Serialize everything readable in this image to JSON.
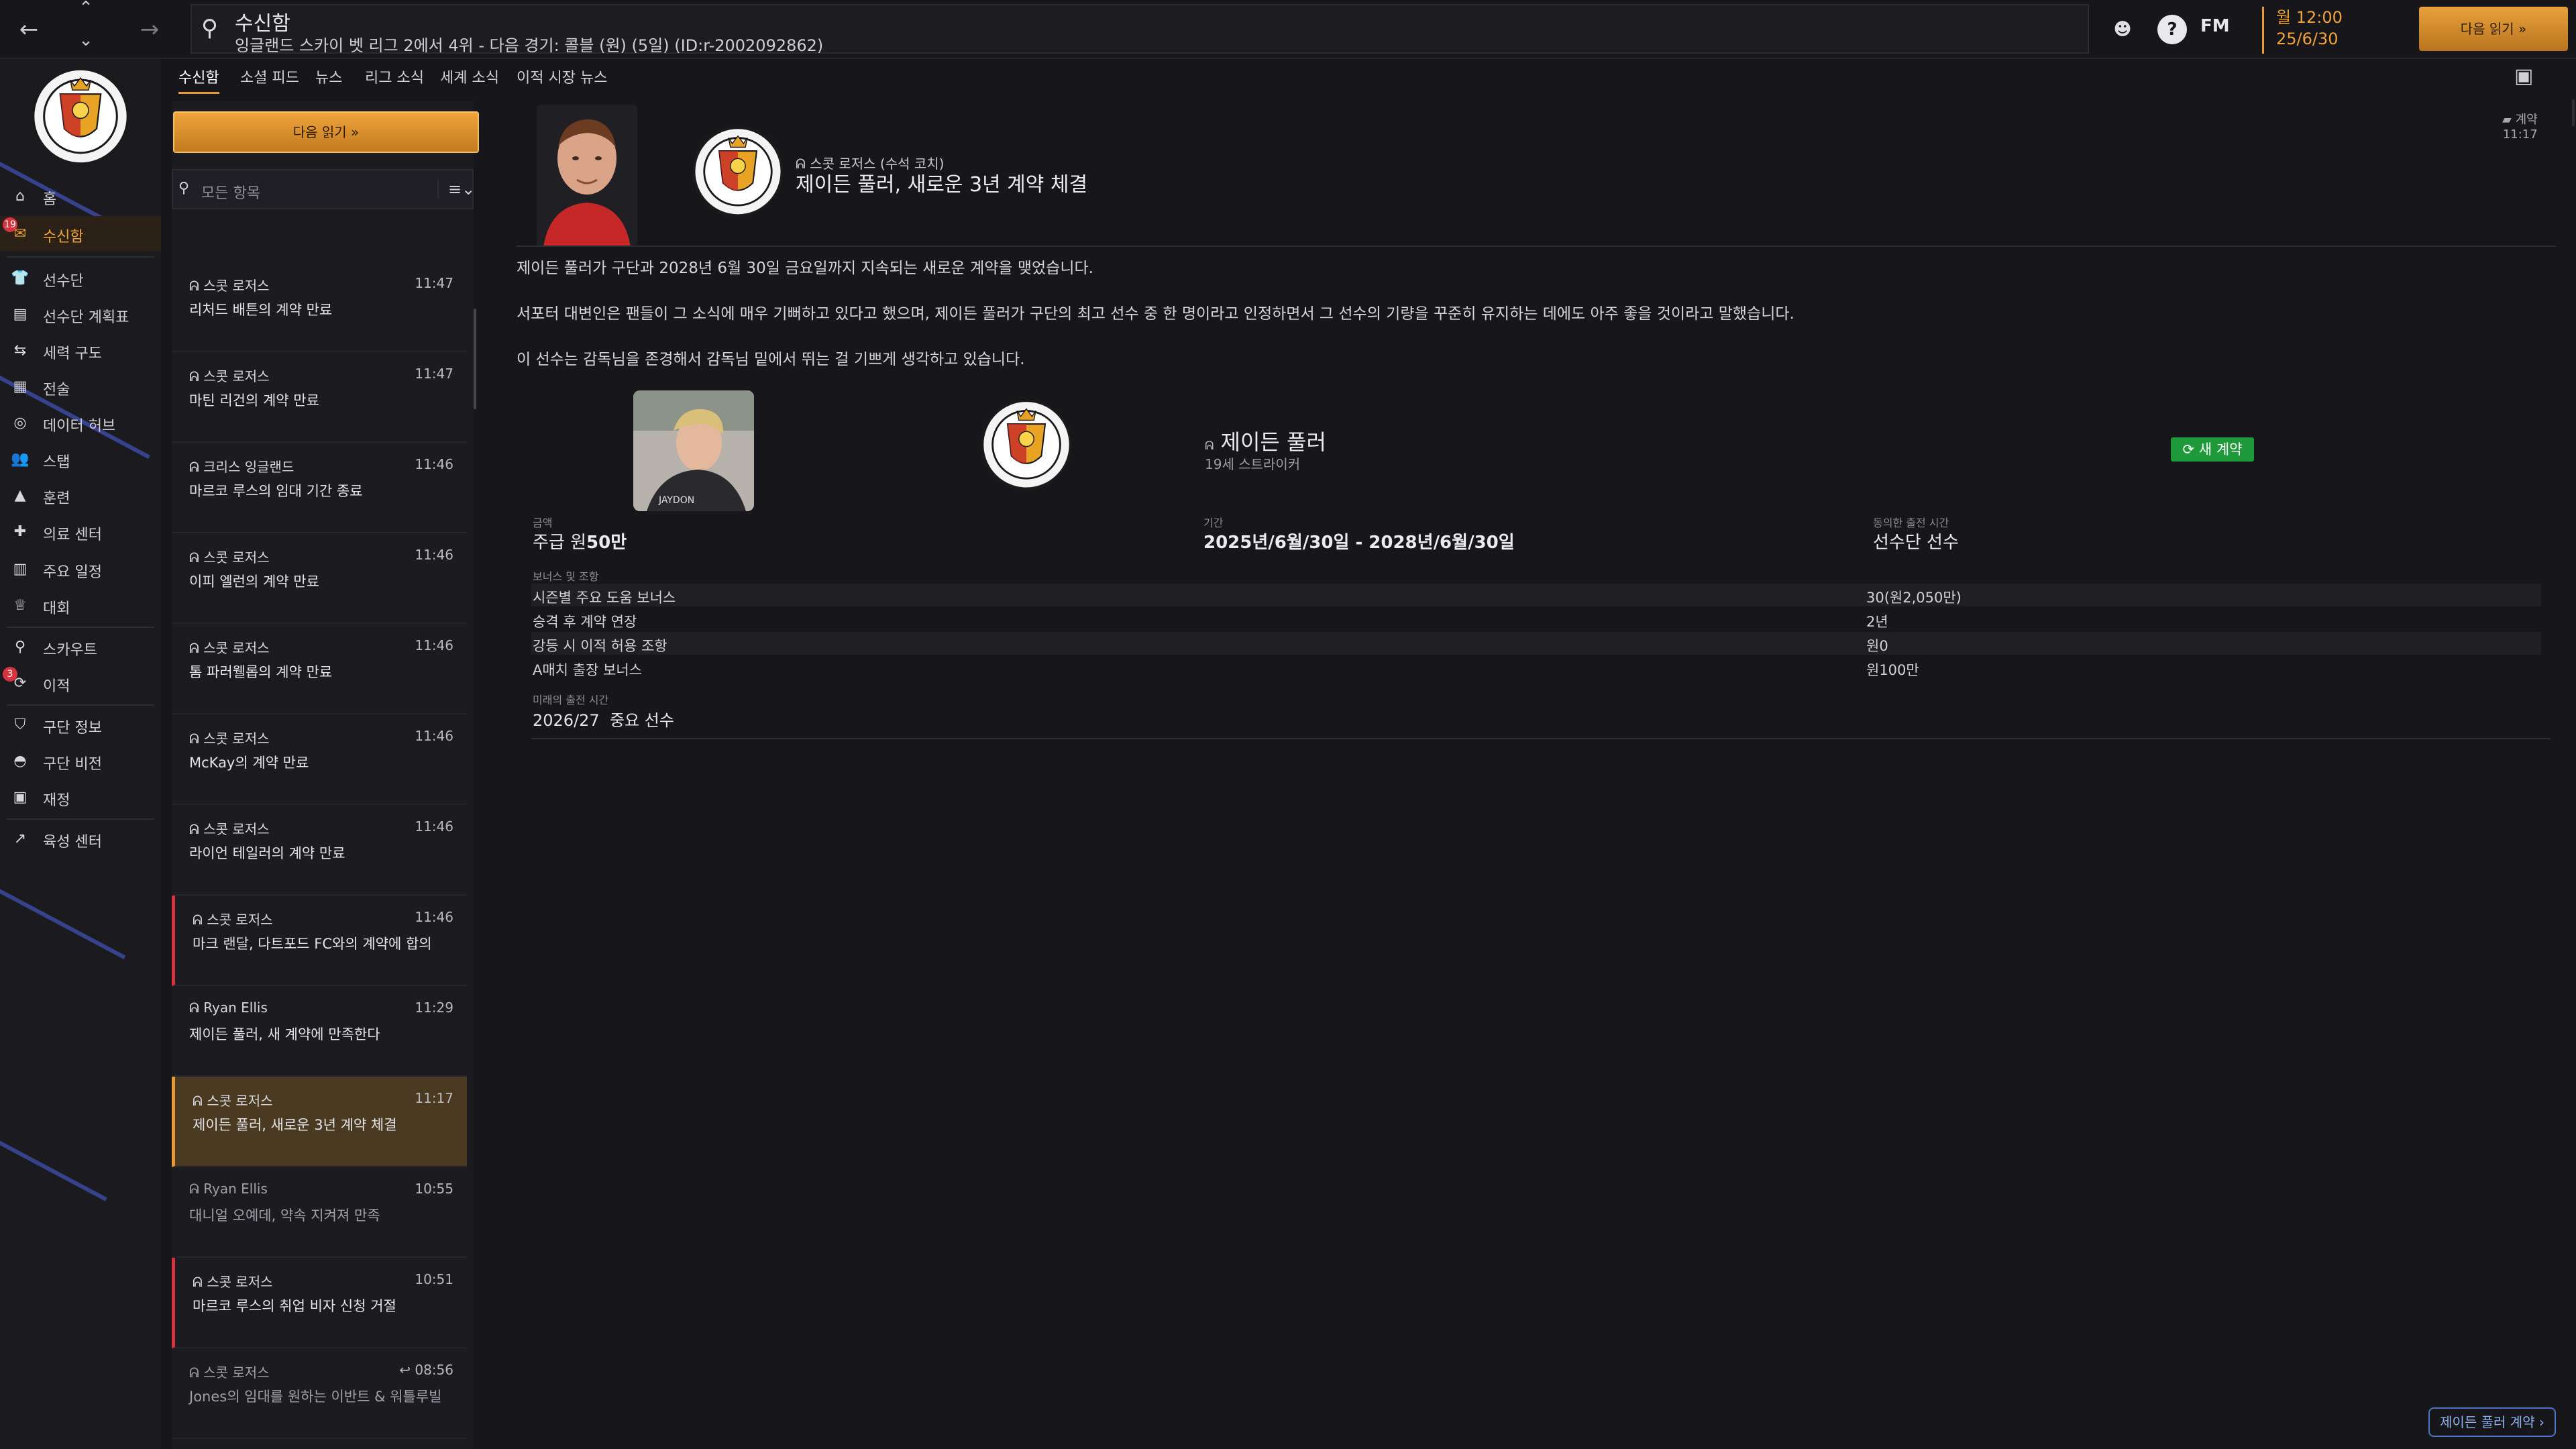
{
  "window": {
    "title": "수신함",
    "subtitle": "잉글랜드 스카이 벳 리그 2에서 4위 - 다음 경기: 콜블 (원) (5일) (ID:r-2002092862)"
  },
  "topbar": {
    "fm_label": "FM",
    "time": "월 12:00",
    "date": "25/6/30",
    "continue_label": "다음 읽기"
  },
  "sidebar": {
    "items": [
      {
        "label": "홈",
        "icon": "home-icon"
      },
      {
        "label": "수신함",
        "icon": "inbox-icon",
        "badge": "19",
        "active": true
      },
      {
        "label": "선수단",
        "icon": "shirt-icon"
      },
      {
        "label": "선수단 계획표",
        "icon": "clipboard-icon"
      },
      {
        "label": "세력 구도",
        "icon": "dynamics-icon"
      },
      {
        "label": "전술",
        "icon": "tactics-icon"
      },
      {
        "label": "데이터 허브",
        "icon": "data-hub-icon"
      },
      {
        "label": "스탭",
        "icon": "staff-icon"
      },
      {
        "label": "훈련",
        "icon": "training-icon"
      },
      {
        "label": "의료 센터",
        "icon": "medical-icon"
      },
      {
        "label": "주요 일정",
        "icon": "calendar-icon"
      },
      {
        "label": "대회",
        "icon": "trophy-icon"
      },
      {
        "label": "스카우트",
        "icon": "scout-icon"
      },
      {
        "label": "이적",
        "icon": "transfer-icon",
        "badge": "3"
      },
      {
        "label": "구단 정보",
        "icon": "club-info-icon"
      },
      {
        "label": "구단 비전",
        "icon": "vision-icon"
      },
      {
        "label": "재정",
        "icon": "finance-icon"
      },
      {
        "label": "육성 센터",
        "icon": "development-icon"
      }
    ]
  },
  "tabs": [
    "수신함",
    "소셜 피드",
    "뉴스",
    "리그 소식",
    "세계 소식",
    "이적 시장 뉴스"
  ],
  "list": {
    "read_next": "다음 읽기  »",
    "filter_placeholder": "모든 항목",
    "messages": [
      {
        "sender": "스콧 로저스",
        "time": "11:47",
        "subject": "리처드 배튼의 계약 만료",
        "flag": false,
        "sel": false,
        "read": false
      },
      {
        "sender": "스콧 로저스",
        "time": "11:47",
        "subject": "마틴 리건의 계약 만료",
        "flag": false,
        "sel": false,
        "read": false
      },
      {
        "sender": "크리스 잉글랜드",
        "time": "11:46",
        "subject": "마르코 루스의 임대 기간 종료",
        "flag": false,
        "sel": false,
        "read": false
      },
      {
        "sender": "스콧 로저스",
        "time": "11:46",
        "subject": "이피 엘런의 계약 만료",
        "flag": false,
        "sel": false,
        "read": false
      },
      {
        "sender": "스콧 로저스",
        "time": "11:46",
        "subject": "톰 파러웰롭의 계약 만료",
        "flag": false,
        "sel": false,
        "read": false
      },
      {
        "sender": "스콧 로저스",
        "time": "11:46",
        "subject": "McKay의 계약 만료",
        "flag": false,
        "sel": false,
        "read": false
      },
      {
        "sender": "스콧 로저스",
        "time": "11:46",
        "subject": "라이언 테일러의 계약 만료",
        "flag": false,
        "sel": false,
        "read": false
      },
      {
        "sender": "스콧 로저스",
        "time": "11:46",
        "subject": "마크 랜달, 다트포드 FC와의 계약에 합의",
        "flag": true,
        "sel": false,
        "read": false
      },
      {
        "sender": "Ryan Ellis",
        "time": "11:29",
        "subject": "제이든 풀러, 새 계약에 만족한다",
        "flag": false,
        "sel": false,
        "read": false
      },
      {
        "sender": "스콧 로저스",
        "time": "11:17",
        "subject": "제이든 풀러, 새로운 3년 계약 체결",
        "flag": false,
        "sel": true,
        "read": false
      },
      {
        "sender": "Ryan Ellis",
        "time": "10:55",
        "subject": "대니얼 오예데, 약속 지켜져 만족",
        "flag": false,
        "sel": false,
        "read": true
      },
      {
        "sender": "스콧 로저스",
        "time": "10:51",
        "subject": "마르코 루스의 취업 비자 신청 거절",
        "flag": true,
        "sel": false,
        "read": false
      },
      {
        "sender": "스콧 로저스",
        "time": "↩ 08:56",
        "subject": "Jones의 임대를 원하는 이반트 & 워틀루빌",
        "flag": false,
        "sel": false,
        "read": true
      }
    ]
  },
  "detail": {
    "sender": "스콧 로저스 (수석 코치)",
    "title": "제이든 풀러, 새로운 3년 계약 체결",
    "corner_tag": "계약",
    "corner_time": "11:17",
    "paragraphs": [
      "제이든 풀러가 구단과 2028년 6월 30일 금요일까지 지속되는 새로운 계약을 맺었습니다.",
      "서포터 대변인은 팬들이 그 소식에 매우 기뻐하고 있다고 했으며, 제이든 풀러가 구단의 최고 선수 중 한 명이라고 인정하면서 그 선수의 기량을 꾸준히 유지하는 데에도 아주 좋을 것이라고 말했습니다.",
      "이 선수는 감독님을 존경해서 감독님 밑에서 뛰는 걸 기쁘게 생각하고 있습니다."
    ],
    "card": {
      "name": "제이든 풀러",
      "sub": "19세 스트라이커",
      "badge": "새 계약",
      "photo_label": "JAYDON"
    },
    "fields": {
      "wage_label": "금액",
      "wage_prefix": "주급 원",
      "wage_value": "50만",
      "term_label": "기간",
      "term_value": "2025년/6월/30일 - 2028년/6월/30일",
      "role_label": "동의한 출전 시간",
      "role_value": "선수단 선수"
    },
    "bonus_label": "보너스 및 조항",
    "bonuses": [
      {
        "k": "시즌별 주요 도움 보너스",
        "v": "30(원2,050만)"
      },
      {
        "k": "승격 후 계약 연장",
        "v": "2년"
      },
      {
        "k": "강등 시 이적 허용 조항",
        "v": "원0"
      },
      {
        "k": "A매치 출장 보너스",
        "v": "원100만"
      }
    ],
    "future_label": "미래의 출전 시간",
    "future_season": "2026/27",
    "future_role": "중요 선수",
    "contract_btn": "제이든 풀러 계약 ›"
  }
}
